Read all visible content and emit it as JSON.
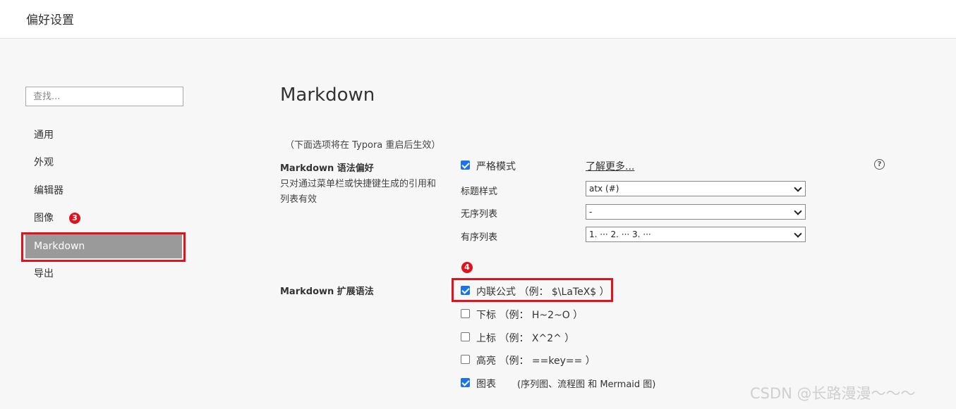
{
  "window": {
    "title": "偏好设置"
  },
  "sidebar": {
    "search_placeholder": "查找...",
    "items": [
      {
        "label": "通用"
      },
      {
        "label": "外观"
      },
      {
        "label": "编辑器"
      },
      {
        "label": "图像"
      },
      {
        "label": "Markdown",
        "active": true
      },
      {
        "label": "导出"
      }
    ]
  },
  "annotations": {
    "step3": "3",
    "step4": "4",
    "color": "#e0121c"
  },
  "main": {
    "title": "Markdown",
    "restart_note": "（下面选项将在 Typora 重启后生效）",
    "syntax_pref": {
      "heading": "Markdown 语法偏好",
      "description": "只对通过菜单栏或快捷键生成的引用和列表有效",
      "strict_mode": {
        "label": "严格模式",
        "checked": true
      },
      "learn_more": "了解更多...",
      "heading_style": {
        "label": "标题样式",
        "value": "atx (#)"
      },
      "unordered_list": {
        "label": "无序列表",
        "value": "-"
      },
      "ordered_list": {
        "label": "有序列表",
        "value": "1. ··· 2. ··· 3. ···"
      }
    },
    "extended": {
      "heading": "Markdown 扩展语法",
      "options": [
        {
          "label": "内联公式 （例： $\\LaTeX$ ）",
          "checked": true
        },
        {
          "label": "下标 （例： H~2~O ）",
          "checked": false
        },
        {
          "label": "上标 （例： X^2^ ）",
          "checked": false
        },
        {
          "label": "高亮 （例： ==key== ）",
          "checked": false
        },
        {
          "label": "图表 ",
          "checked": true,
          "note": "(序列图、流程图 和 Mermaid 图)"
        }
      ]
    }
  },
  "watermark": "CSDN @长路漫漫～～～",
  "accent_color": "#1a73e8"
}
